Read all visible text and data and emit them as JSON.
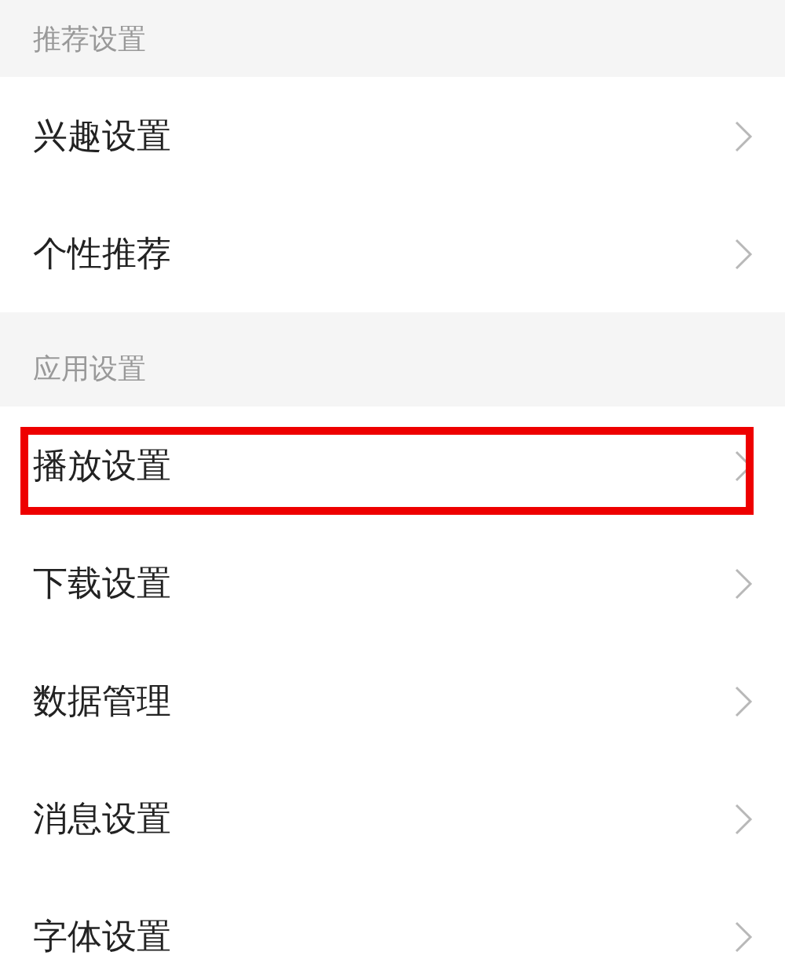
{
  "sections": [
    {
      "title": "推荐设置",
      "items": [
        {
          "label": "兴趣设置",
          "highlighted": false
        },
        {
          "label": "个性推荐",
          "highlighted": false
        }
      ]
    },
    {
      "title": "应用设置",
      "items": [
        {
          "label": "播放设置",
          "highlighted": true
        },
        {
          "label": "下载设置",
          "highlighted": false
        },
        {
          "label": "数据管理",
          "highlighted": false
        },
        {
          "label": "消息设置",
          "highlighted": false
        },
        {
          "label": "字体设置",
          "highlighted": false
        }
      ]
    }
  ]
}
